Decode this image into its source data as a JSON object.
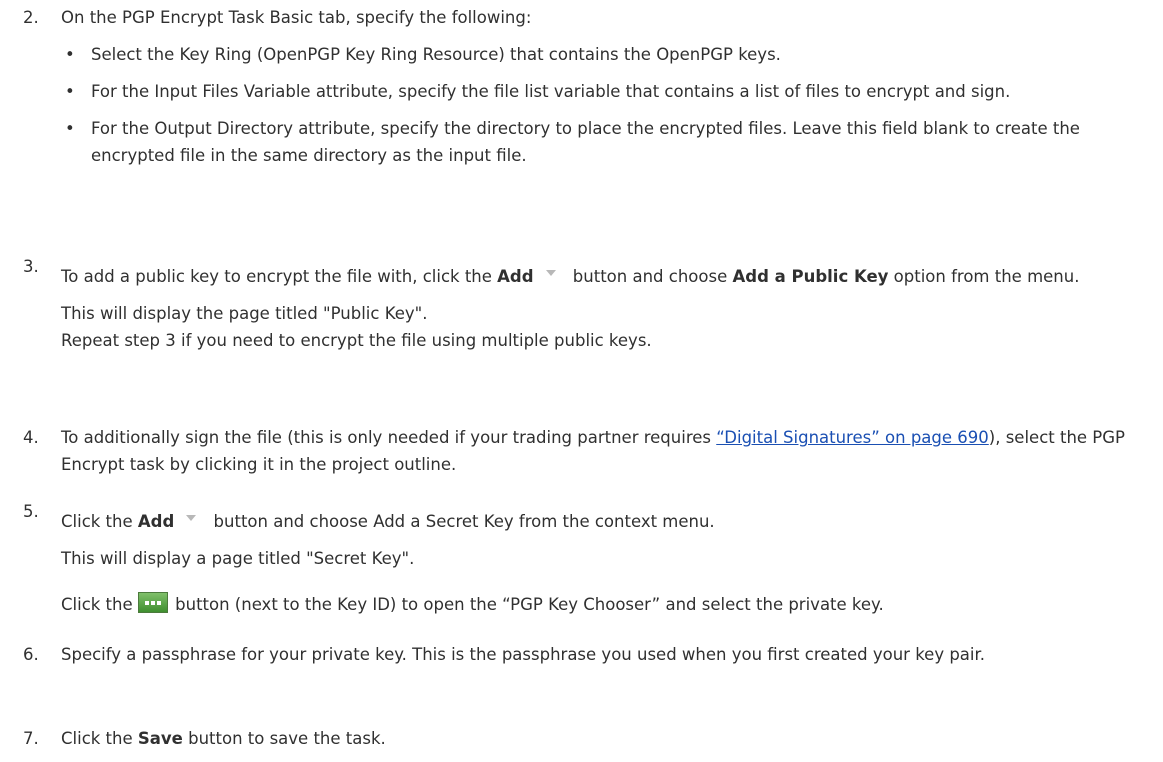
{
  "step2": {
    "number": "2.",
    "intro": "On the PGP Encrypt Task Basic tab, specify the following:",
    "bullets": [
      "Select the Key Ring (OpenPGP Key Ring Resource) that contains the OpenPGP keys.",
      "For the Input Files Variable attribute, specify the file list variable that contains a list of files to encrypt and sign.",
      "For the Output Directory attribute, specify the directory to place the encrypted files. Leave this field blank to create the encrypted file in the same directory as the input file."
    ],
    "bullet_glyph": "•"
  },
  "step3": {
    "number": "3.",
    "text_before": "To add a public key to encrypt the file with, click the ",
    "add_label": "Add",
    "text_middle": " button and choose ",
    "option_label": "Add a Public Key",
    "text_after": " option from the menu.",
    "note1": "This will display the page titled \"Public Key\".",
    "note2": "Repeat step 3 if you need to encrypt the file using multiple public keys."
  },
  "step4": {
    "number": "4.",
    "text_before": "To additionally sign the file (this is only needed if your trading partner requires ",
    "link_text": "“Digital Signatures” on page 690",
    "text_after": "), select the PGP Encrypt task by clicking it in the project outline."
  },
  "step5": {
    "number": "5.",
    "text_before": "Click the ",
    "add_label": "Add",
    "text_after": " button and choose Add a Secret Key from the context menu.",
    "note1": "This will display a page titled \"Secret Key\".",
    "click_the": "Click the ",
    "chooser_text": " button (next to the Key ID) to open the “PGP Key Chooser” and select the private key."
  },
  "step6": {
    "number": "6.",
    "text": "Specify a passphrase for your private key.  This is the passphrase you used when you first created your key pair."
  },
  "step7": {
    "number": "7.",
    "text_before": "Click the ",
    "save_label": "Save",
    "text_after": " button to save the task."
  }
}
